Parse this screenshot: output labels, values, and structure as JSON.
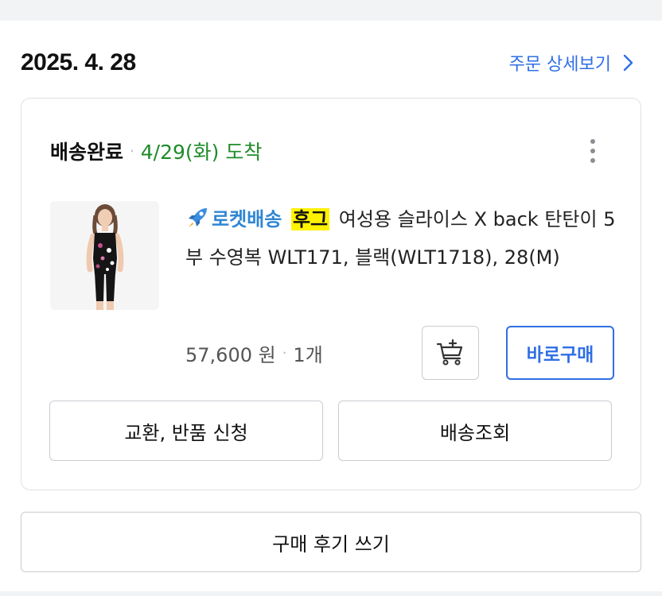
{
  "order": {
    "date": "2025. 4. 28",
    "detail_link_label": "주문 상세보기"
  },
  "shipment": {
    "status": "배송완료",
    "arrival": "4/29(화) 도착"
  },
  "product": {
    "badge_label": "로켓배송",
    "review_tag": "후그",
    "name": "여성용 슬라이스 X back 탄탄이 5부 수영복 WLT171, 블랙(WLT1718), 28(M)",
    "price": "57,600 원",
    "quantity": "1개"
  },
  "actions": {
    "buy_now_label": "바로구매",
    "exchange_return_label": "교환, 반품 신청",
    "tracking_label": "배송조회",
    "write_review_label": "구매 후기 쓰기"
  },
  "colors": {
    "accent": "#2f6fe4",
    "arrival_green": "#1f8c2a",
    "rocket_blue": "#2f86d4",
    "highlight_yellow": "#fff200"
  },
  "icons": {
    "detail_chevron": "chevron-right-icon",
    "menu": "more-vertical-icon",
    "rocket": "rocket-icon",
    "cart": "add-to-cart-icon"
  }
}
